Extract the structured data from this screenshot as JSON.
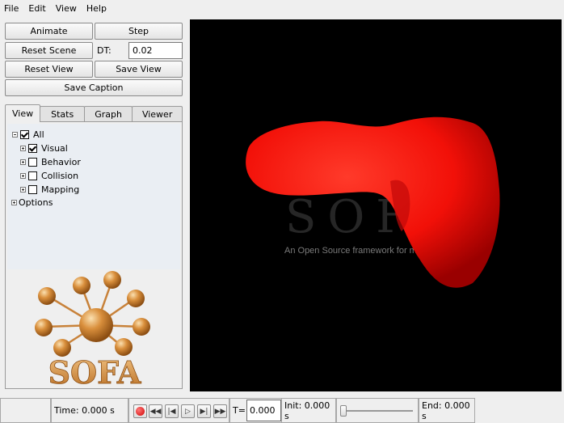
{
  "menu": {
    "items": [
      {
        "label": "File"
      },
      {
        "label": "Edit"
      },
      {
        "label": "View"
      },
      {
        "label": "Help"
      }
    ]
  },
  "controls": {
    "animate_label": "Animate",
    "step_label": "Step",
    "reset_scene_label": "Reset Scene",
    "dt_label": "DT:",
    "dt_value": "0.02",
    "reset_view_label": "Reset View",
    "save_view_label": "Save View",
    "save_caption_label": "Save Caption"
  },
  "tabs": [
    {
      "label": "View",
      "active": true
    },
    {
      "label": "Stats",
      "active": false
    },
    {
      "label": "Graph",
      "active": false
    },
    {
      "label": "Viewer",
      "active": false
    }
  ],
  "tree": {
    "all_label": "All",
    "all_checked": true,
    "items": [
      {
        "label": "Visual",
        "checked": true
      },
      {
        "label": "Behavior",
        "checked": false
      },
      {
        "label": "Collision",
        "checked": false
      },
      {
        "label": "Mapping",
        "checked": false
      }
    ],
    "options_label": "Options"
  },
  "logo": {
    "text": "SOFA",
    "color": "#c98a3c"
  },
  "viewer": {
    "watermark_title": "SOFA",
    "watermark_tagline": "An Open Source framework for medi",
    "background": "#000000",
    "object_color": "#ff1a10"
  },
  "statusbar": {
    "time_label": "Time: 0.000 s",
    "t_label": "T=",
    "t_value": "0.000",
    "init_label": "Init: 0.000 s",
    "end_label": "End: 0.000 s",
    "slider_position": 0
  },
  "icons": {
    "record": "record-icon",
    "rewind": "rewind-icon",
    "step_back": "step-back-icon",
    "play": "play-icon",
    "step_forward": "step-forward-icon",
    "fast_forward": "fast-forward-icon"
  }
}
